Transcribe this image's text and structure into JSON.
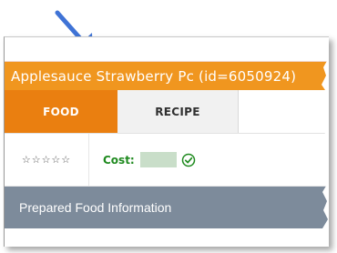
{
  "header": {
    "title": "Applesauce Strawberry Pc (id=6050924)"
  },
  "tabs": [
    {
      "label": "FOOD",
      "active": true
    },
    {
      "label": "RECIPE",
      "active": false
    }
  ],
  "rating": {
    "stars_text": "☆☆☆☆☆"
  },
  "cost": {
    "label": "Cost:",
    "status_icon": "check-circle-icon"
  },
  "section": {
    "label": "Prepared Food Information"
  },
  "colors": {
    "title_bar": "#f0961f",
    "active_tab": "#ea7f10",
    "cost_green": "#1f8a1f",
    "section_bar": "#7d8b9b",
    "arrow": "#3f73d6"
  },
  "annotation": {
    "arrow_icon": "callout-arrow-icon"
  }
}
